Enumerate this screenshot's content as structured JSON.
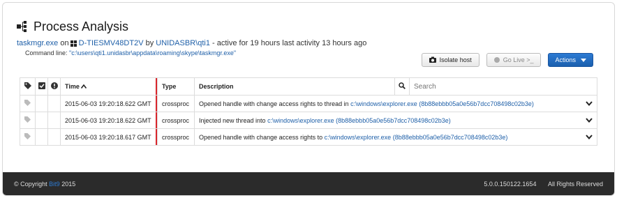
{
  "header": {
    "title": "Process Analysis",
    "process_name": "taskmgr.exe",
    "on_text": "on",
    "host": "D-TIESMV48DT2V",
    "by_text": "by",
    "user": "UNIDASBR\\qti1",
    "activity": "- active for 19 hours last activity 13 hours ago",
    "command_label": "Command line:",
    "command_value": "\"c:\\users\\qti1.unidasbr\\appdata\\roaming\\skype\\taskmgr.exe\""
  },
  "actions": {
    "isolate_label": "Isolate host",
    "golive_label": "Go Live >_",
    "actions_label": "Actions"
  },
  "table": {
    "headers": {
      "time": "Time",
      "type": "Type",
      "description": "Description"
    },
    "search_placeholder": "Search",
    "rows": [
      {
        "time": "2015-06-03 19:20:18.622 GMT",
        "type": "crossproc",
        "desc_text": "Opened handle with change access rights to thread in",
        "desc_path": "c:\\windows\\explorer.exe",
        "desc_hash": "(8b88ebbb05a0e56b7dcc708498c02b3e)"
      },
      {
        "time": "2015-06-03 19:20:18.622 GMT",
        "type": "crossproc",
        "desc_text": "Injected new thread into",
        "desc_path": "c:\\windows\\explorer.exe",
        "desc_hash": "(8b88ebbb05a0e56b7dcc708498c02b3e)"
      },
      {
        "time": "2015-06-03 19:20:18.617 GMT",
        "type": "crossproc",
        "desc_text": "Opened handle with change access rights to",
        "desc_path": "c:\\windows\\explorer.exe",
        "desc_hash": "(8b88ebbb05a0e56b7dcc708498c02b3e)"
      }
    ]
  },
  "footer": {
    "copyright_prefix": "© Copyright",
    "brand": "Bit9",
    "year": "2015",
    "version": "5.0.0.150122.1654",
    "rights": "All Rights Reserved"
  },
  "colors": {
    "link": "#1e5fa8",
    "accent_bar": "#d9262c",
    "primary_button": "#1b5fae",
    "footer_bg": "#2b2b2b"
  },
  "icons": {
    "title": "process-tree-icon",
    "host_os": "windows-icon",
    "isolate": "camera-icon",
    "tag_column": "tag-icon",
    "check_column": "checkbox-icon",
    "alert_column": "alert-icon",
    "sort": "sort-ascending-icon",
    "search": "search-icon",
    "row_expand": "chevron-down-icon"
  }
}
